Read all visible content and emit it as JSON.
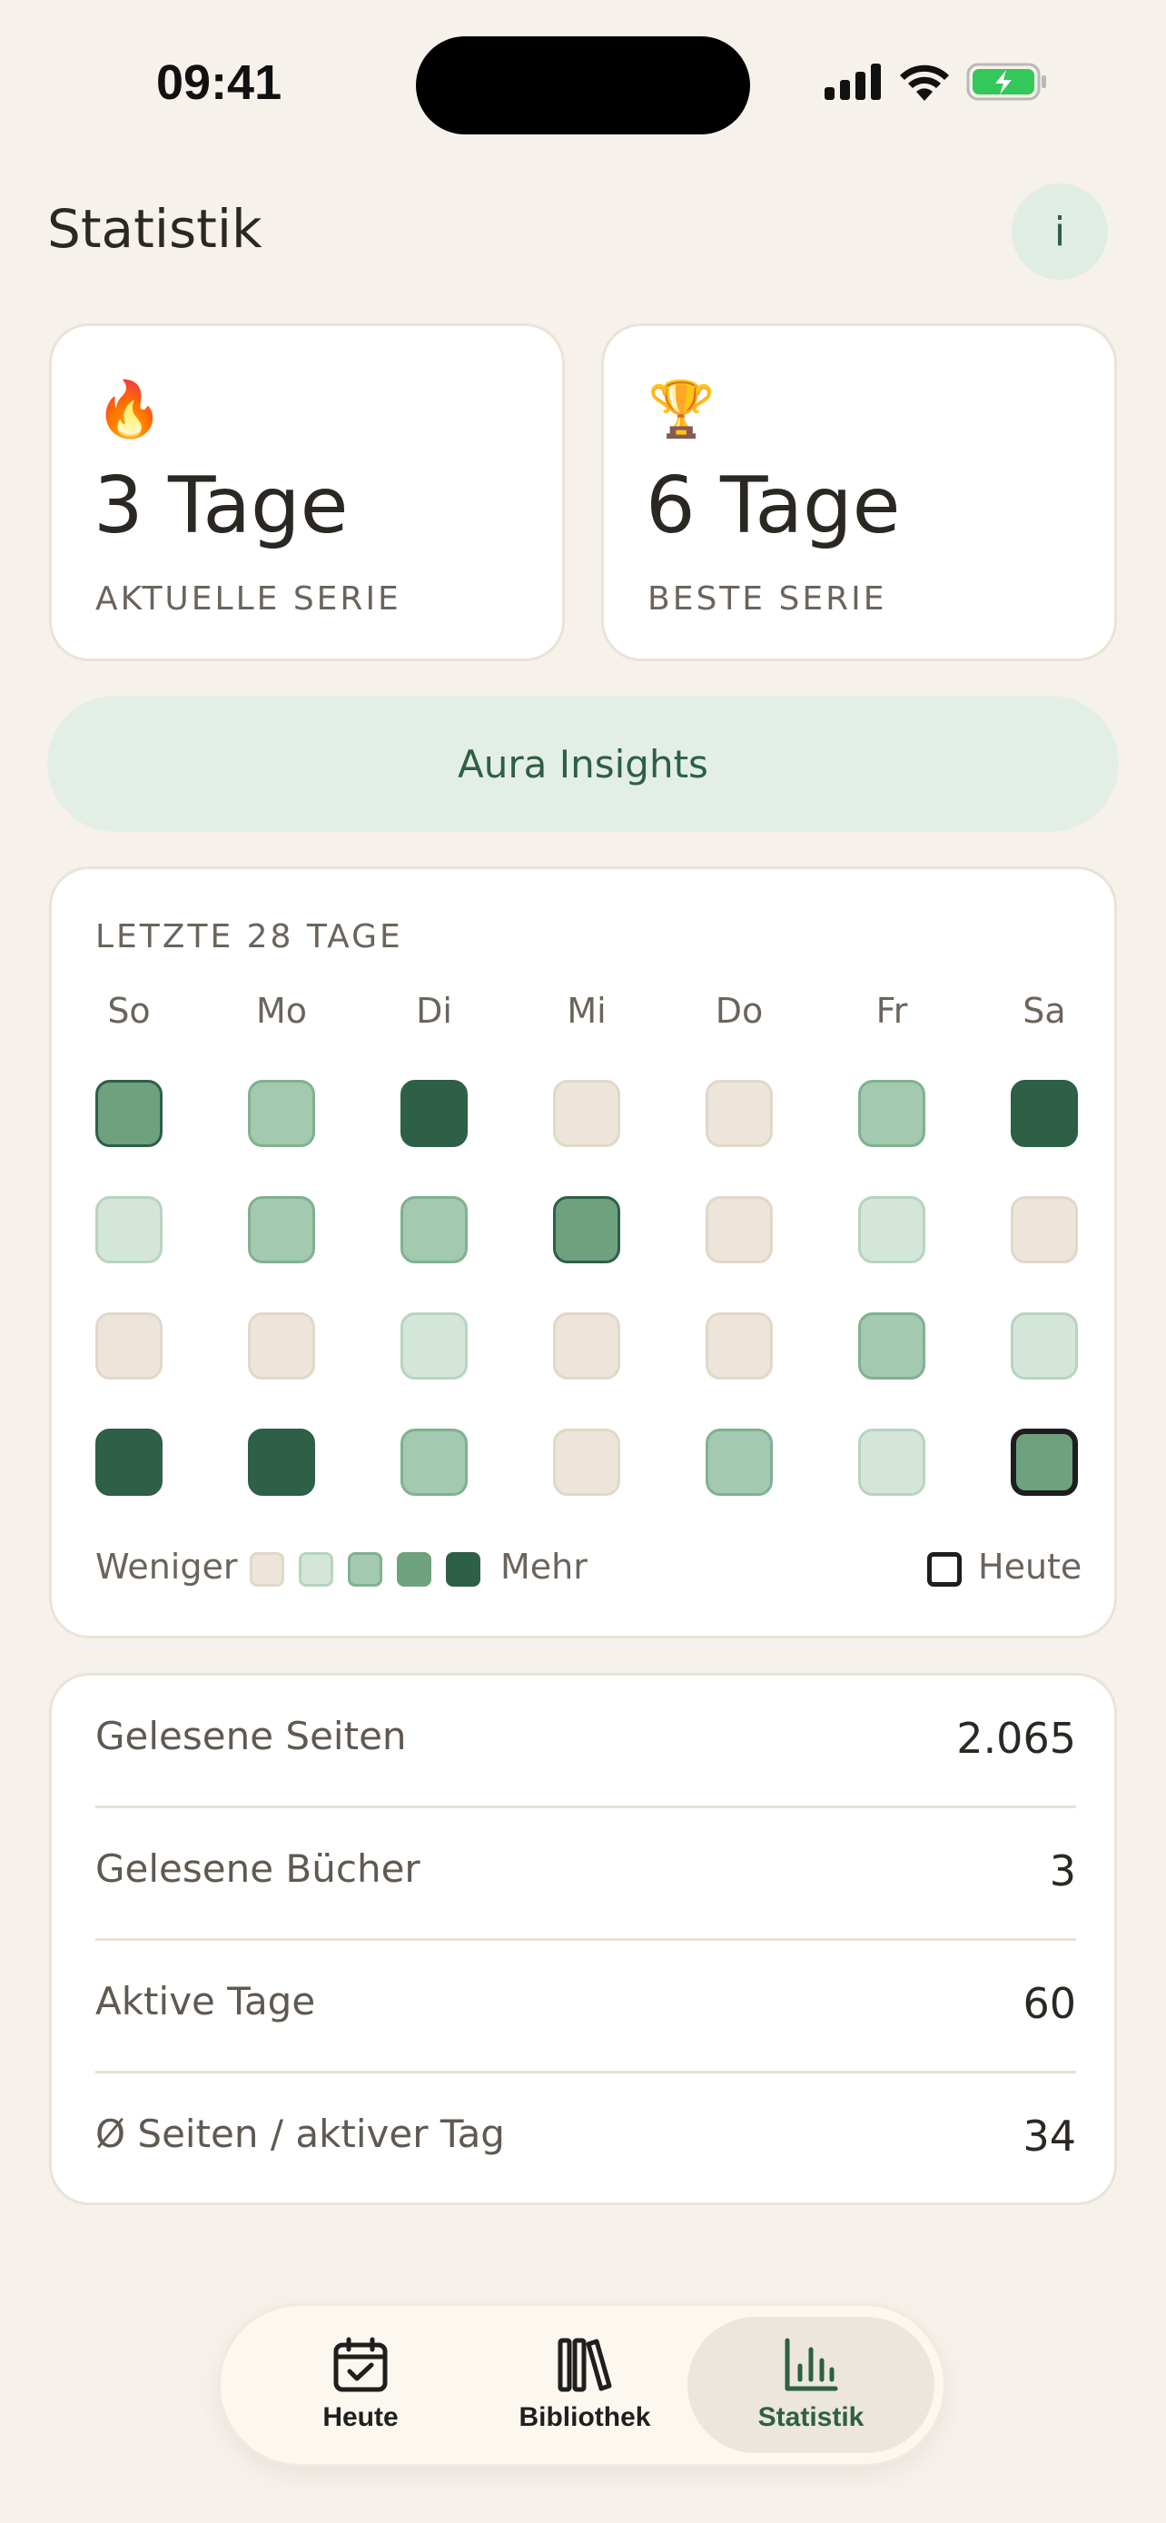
{
  "status_bar": {
    "time": "09:41",
    "icons": [
      "signal-icon",
      "wifi-icon",
      "battery-charging-icon"
    ],
    "battery_color": "#34c759"
  },
  "header": {
    "title": "Statistik",
    "info_button_label": "i"
  },
  "streaks": {
    "current": {
      "emoji": "🔥",
      "value": "3 Tage",
      "label": "AKTUELLE SERIE"
    },
    "best": {
      "emoji": "🏆",
      "value": "6 Tage",
      "label": "BESTE SERIE"
    }
  },
  "insights_button": {
    "label": "Aura Insights"
  },
  "heatmap": {
    "title": "LETZTE 28 TAGE",
    "weekdays": [
      "So",
      "Mo",
      "Di",
      "Mi",
      "Do",
      "Fr",
      "Sa"
    ],
    "levels": [
      [
        3,
        2,
        4,
        0,
        0,
        2,
        4
      ],
      [
        1,
        2,
        2,
        3,
        0,
        1,
        0
      ],
      [
        0,
        0,
        1,
        0,
        0,
        2,
        1
      ],
      [
        4,
        4,
        2,
        0,
        2,
        1,
        3
      ]
    ],
    "today_row": 3,
    "today_col": 6,
    "legend": {
      "less": "Weniger",
      "more": "Mehr",
      "today": "Heute"
    },
    "colors": [
      "#ede5d9",
      "#d4e6da",
      "#a3c9b0",
      "#6ea17e",
      "#2e5f47"
    ]
  },
  "stats": [
    {
      "label": "Gelesene Seiten",
      "value": "2.065"
    },
    {
      "label": "Gelesene Bücher",
      "value": "3"
    },
    {
      "label": "Aktive Tage",
      "value": "60"
    },
    {
      "label": "Ø Seiten / aktiver Tag",
      "value": "34"
    }
  ],
  "tab_bar": {
    "tabs": [
      {
        "label": "Heute",
        "icon": "calendar-check-icon",
        "active": false
      },
      {
        "label": "Bibliothek",
        "icon": "books-icon",
        "active": false
      },
      {
        "label": "Statistik",
        "icon": "bar-chart-icon",
        "active": true
      }
    ],
    "accent_color": "#2e5f47"
  }
}
